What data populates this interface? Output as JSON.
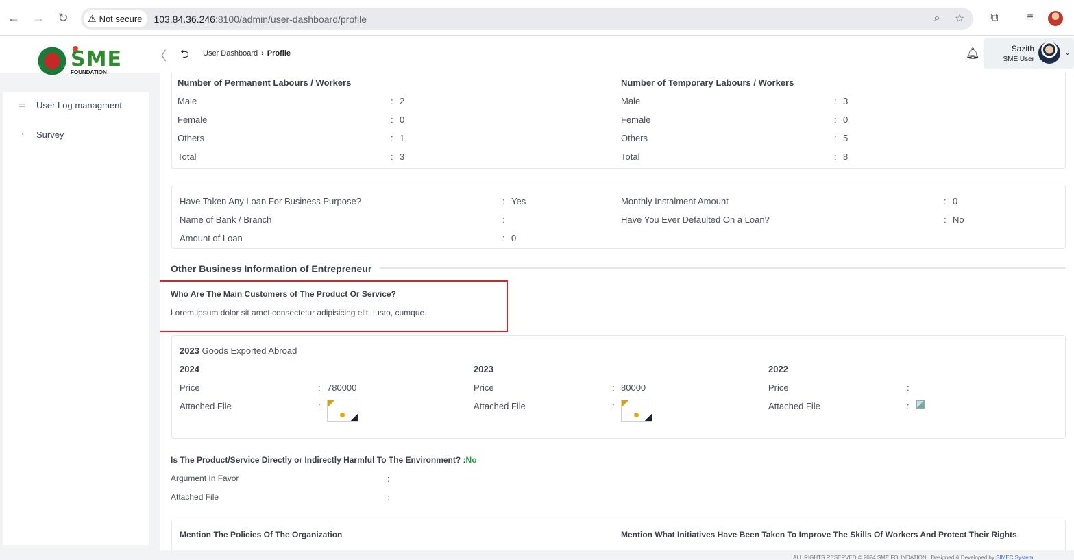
{
  "browser": {
    "security_label": "Not secure",
    "url_host": "103.84.36.246",
    "url_rest": ":8100/admin/user-dashboard/profile"
  },
  "header": {
    "logo_text": "SME",
    "logo_subtext": "FOUNDATION",
    "breadcrumb": [
      "User Dashboard",
      "Profile"
    ],
    "user_name": "Sazith",
    "user_role": "SME User"
  },
  "sidebar": {
    "items": [
      {
        "label": "User Log managment",
        "icon": "log-icon"
      },
      {
        "label": "Survey",
        "icon": "pie-chart-icon"
      }
    ]
  },
  "labour": {
    "permanent": {
      "title": "Number of Permanent Labours / Workers",
      "rows": [
        {
          "label": "Male",
          "value": "2"
        },
        {
          "label": "Female",
          "value": "0"
        },
        {
          "label": "Others",
          "value": "1"
        },
        {
          "label": "Total",
          "value": "3"
        }
      ]
    },
    "temporary": {
      "title": "Number of Temporary Labours / Workers",
      "rows": [
        {
          "label": "Male",
          "value": "3"
        },
        {
          "label": "Female",
          "value": "0"
        },
        {
          "label": "Others",
          "value": "5"
        },
        {
          "label": "Total",
          "value": "8"
        }
      ]
    }
  },
  "loan": {
    "left": [
      {
        "label": "Have Taken Any Loan For Business Purpose?",
        "value": "Yes"
      },
      {
        "label": "Name of Bank / Branch",
        "value": ""
      },
      {
        "label": "Amount of Loan",
        "value": "0"
      }
    ],
    "right": [
      {
        "label": "Monthly Instalment Amount",
        "value": "0"
      },
      {
        "label": "Have You Ever Defaulted On a Loan?",
        "value": "No"
      }
    ]
  },
  "other_business": {
    "section_title": "Other Business Information of Entrepreneur",
    "customers_question": "Who Are The Main Customers of The Product Or Service?",
    "customers_answer": "Lorem ipsum dolor sit amet consectetur adipisicing elit. Iusto, cumque."
  },
  "exports": {
    "title_year": "2023",
    "title_rest": " Goods Exported Abroad",
    "price_label": "Price",
    "file_label": "Attached File",
    "years": [
      {
        "year": "2024",
        "price": "780000"
      },
      {
        "year": "2023",
        "price": "80000"
      },
      {
        "year": "2022",
        "price": ""
      }
    ]
  },
  "environment": {
    "question": "Is The Product/Service Directly or Indirectly Harmful To The Environment? :",
    "answer": "No",
    "argument_label": "Argument In Favor",
    "file_label": "Attached File"
  },
  "policies": {
    "left_title": "Mention The Policies Of The Organization",
    "right_title": "Mention What Initiatives Have Been Taken To Improve The Skills Of Workers And Protect Their Rights"
  },
  "footer": {
    "text": "ALL RIGHTS RESERVED © 2024 SME FOUNDATION . Designed & Developed by",
    "link": "SIMEC System"
  },
  "colors": {
    "accent_green": "#1f9d3a",
    "highlight_red": "#e31e24"
  }
}
